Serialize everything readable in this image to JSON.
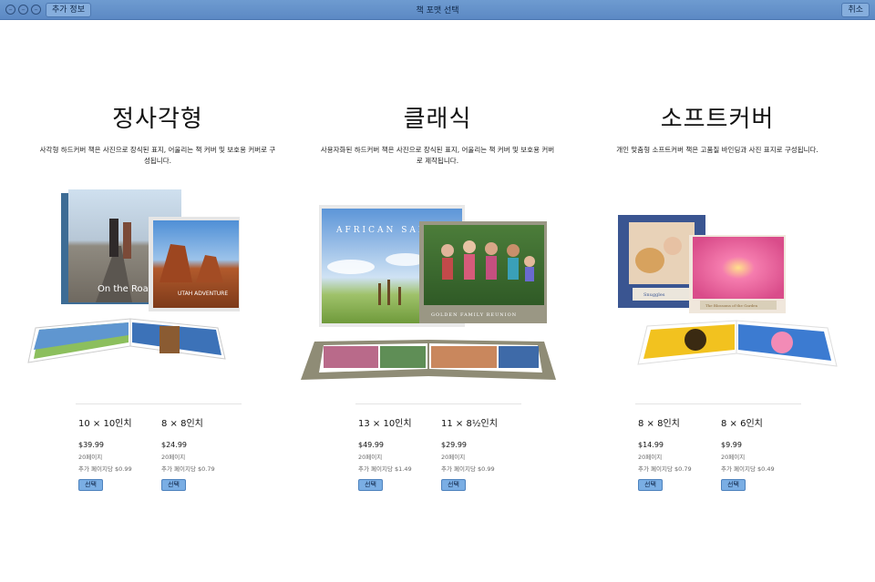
{
  "window": {
    "title": "책 포맷 선택",
    "more_info_label": "추가 정보",
    "cancel_label": "취소"
  },
  "formats": [
    {
      "title": "정사각형",
      "description": "사각형 하드커버 책은 사진으로 장식된 표지, 어울리는 책 커버 및 보호용 커버로 구성됩니다.",
      "cover_texts": [
        "On the Road",
        "UTAH ADVENTURE"
      ],
      "products": [
        {
          "size": "10 × 10인치",
          "price": "$39.99",
          "pages": "20페이지",
          "extra": "추가 페이지당 $0.99",
          "select_label": "선택"
        },
        {
          "size": "8 × 8인치",
          "price": "$24.99",
          "pages": "20페이지",
          "extra": "추가 페이지당 $0.79",
          "select_label": "선택"
        }
      ]
    },
    {
      "title": "클래식",
      "description": "사용자화된 하드커버 책은 사진으로 장식된 표지, 어울리는 책 커버 및 보호용 커버로 제작됩니다.",
      "cover_texts": [
        "AFRICAN SAFARI",
        "GOLDEN FAMILY REUNION"
      ],
      "products": [
        {
          "size": "13 × 10인치",
          "price": "$49.99",
          "pages": "20페이지",
          "extra": "추가 페이지당 $1.49",
          "select_label": "선택"
        },
        {
          "size": "11 × 8½인치",
          "price": "$29.99",
          "pages": "20페이지",
          "extra": "추가 페이지당 $0.99",
          "select_label": "선택"
        }
      ]
    },
    {
      "title": "소프트커버",
      "description": "개인 맞춤형 소프트커버 책은 고품질 바인딩과 사진 표지로 구성됩니다.",
      "cover_texts": [
        "Snuggles",
        "The Blossoms of the Garden"
      ],
      "products": [
        {
          "size": "8 × 8인치",
          "price": "$14.99",
          "pages": "20페이지",
          "extra": "추가 페이지당 $0.79",
          "select_label": "선택"
        },
        {
          "size": "8 × 6인치",
          "price": "$9.99",
          "pages": "20페이지",
          "extra": "추가 페이지당 $0.49",
          "select_label": "선택"
        }
      ]
    }
  ]
}
